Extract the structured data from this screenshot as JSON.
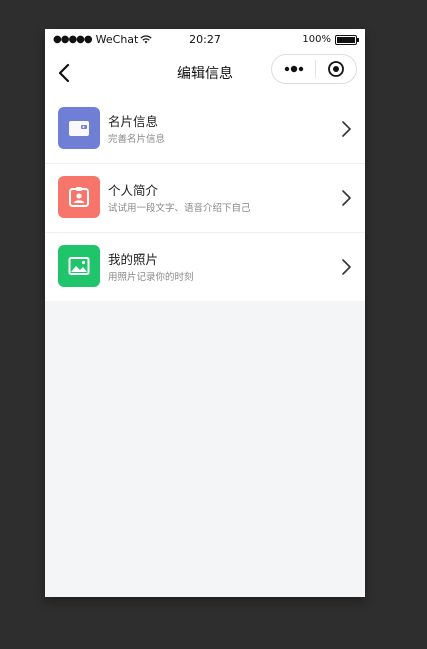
{
  "status_bar": {
    "signal": "●●●●●",
    "carrier": "WeChat",
    "time": "20:27",
    "battery": "100%"
  },
  "nav": {
    "title": "编辑信息",
    "back_icon": "chevron-left-icon",
    "menu_icon": "more-dots-icon",
    "close_icon": "target-circle-icon"
  },
  "items": [
    {
      "title": "名片信息",
      "subtitle": "完善名片信息",
      "icon": "wallet-card-icon",
      "color": "#6f7fd6"
    },
    {
      "title": "个人简介",
      "subtitle": "试试用一段文字、语音介绍下自己",
      "icon": "id-badge-icon",
      "color": "#f7756b"
    },
    {
      "title": "我的照片",
      "subtitle": "用照片记录你的时刻",
      "icon": "photo-icon",
      "color": "#1fc46b"
    }
  ],
  "colors": {
    "page_bg": "#f4f5f7",
    "outer_bg": "#2e2e2e"
  }
}
